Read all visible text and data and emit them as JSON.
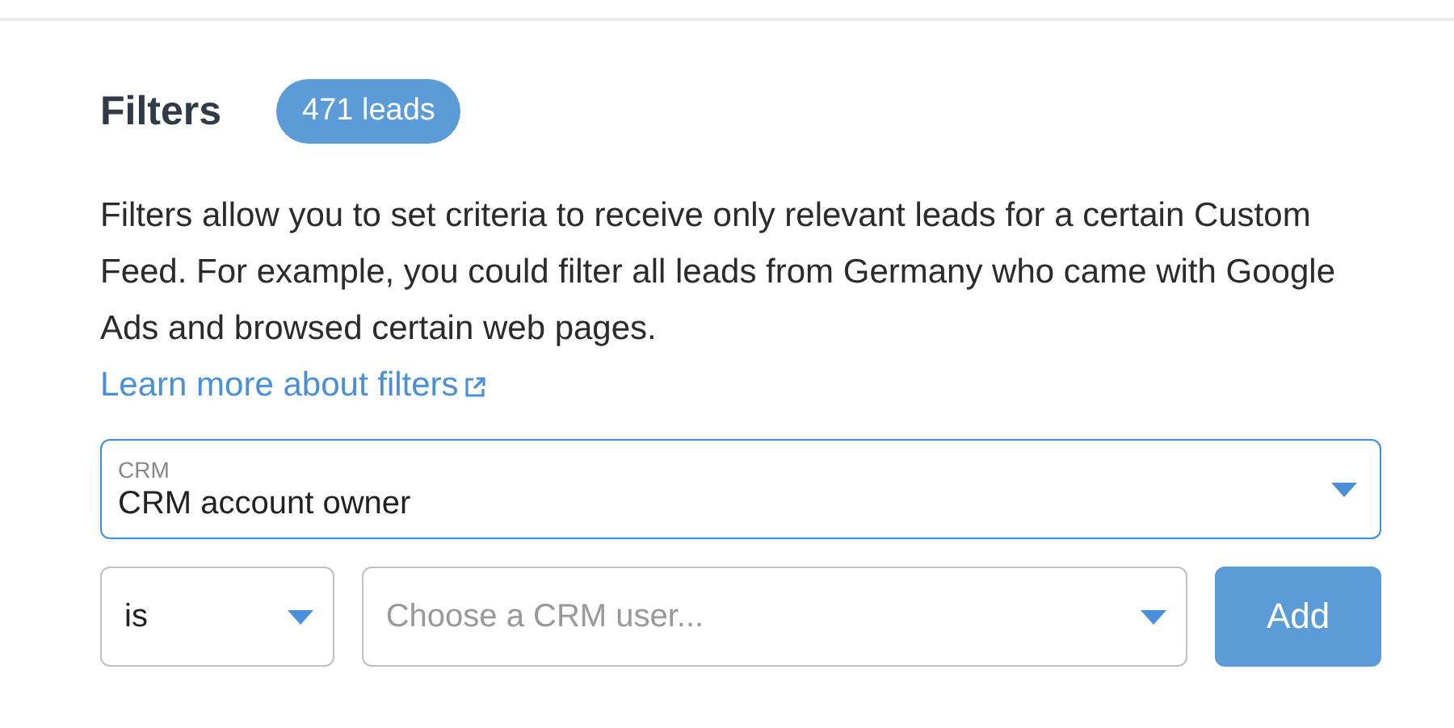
{
  "title": "Filters",
  "count_badge": "471 leads",
  "description": "Filters allow you to set criteria to receive only relevant leads for a certain Custom Feed. For example, you could filter all leads from Germany who came with Google Ads and browsed certain web pages.",
  "learn_more_link": "Learn more about filters",
  "field_select": {
    "label": "CRM",
    "value": "CRM account owner",
    "focused": true
  },
  "operator_select": {
    "value": "is"
  },
  "user_select": {
    "placeholder": "Choose a CRM user..."
  },
  "add_button": "Add"
}
